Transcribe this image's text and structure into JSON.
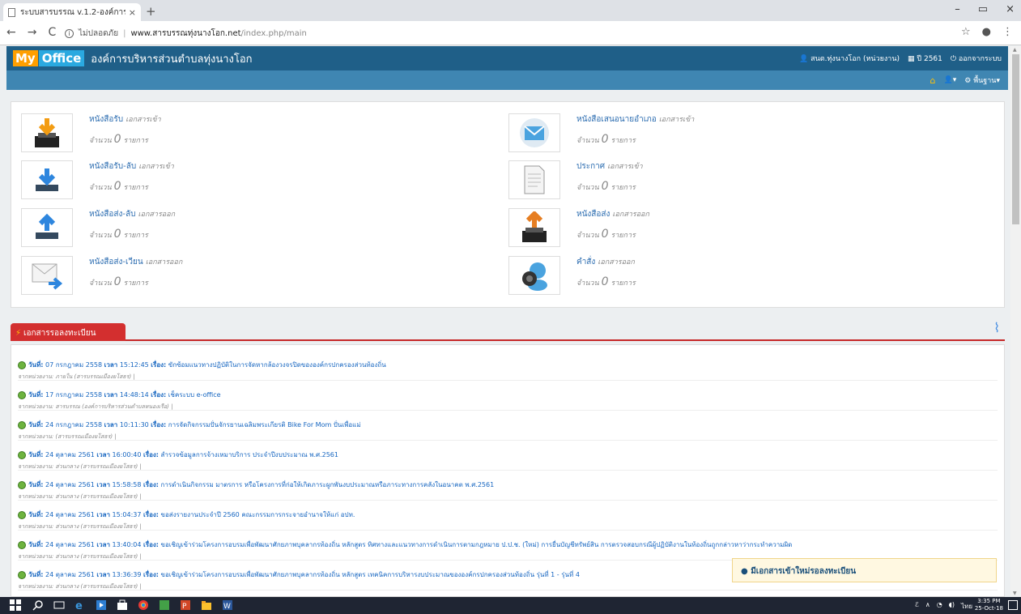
{
  "browser": {
    "tab_title": "ระบบสารบรรณ v.1.2-องค์การบริหาร",
    "tab_close": "×",
    "new_tab": "+",
    "win_min": "–",
    "win_max": "▭",
    "win_close": "×",
    "security": "ไม่ปลอดภัย",
    "url_domain": "www.สารบรรณทุ่งนางโอก.net",
    "url_path": "/index.php/main"
  },
  "app": {
    "logo_my": "My",
    "logo_office": "Office",
    "org_name": "องค์การบริหารส่วนตำบลทุ่งนางโอก",
    "user": "สนต.ทุ่งนางโอก (หน่วยงาน)",
    "year": "ปี 2561",
    "logout": "ออกจากระบบ",
    "menu_basic": "พื้นฐาน"
  },
  "docs": [
    {
      "title": "หนังสือรับ",
      "sub": "เอกสารเข้า",
      "count_prefix": "จำนวน",
      "count": "0",
      "count_suffix": "รายการ",
      "icon": "inbox-tray-icon"
    },
    {
      "title": "หนังสือเสนอนายอำเภอ",
      "sub": "เอกสารเข้า",
      "count_prefix": "จำนวน",
      "count": "0",
      "count_suffix": "รายการ",
      "icon": "envelope-icon"
    },
    {
      "title": "หนังสือรับ-ลับ",
      "sub": "เอกสารเข้า",
      "count_prefix": "จำนวน",
      "count": "0",
      "count_suffix": "รายการ",
      "icon": "download-icon"
    },
    {
      "title": "ประกาศ",
      "sub": "เอกสารเข้า",
      "count_prefix": "จำนวน",
      "count": "0",
      "count_suffix": "รายการ",
      "icon": "document-icon"
    },
    {
      "title": "หนังสือส่ง-ลับ",
      "sub": "เอกสารออก",
      "count_prefix": "จำนวน",
      "count": "0",
      "count_suffix": "รายการ",
      "icon": "upload-icon"
    },
    {
      "title": "หนังสือส่ง",
      "sub": "เอกสารออก",
      "count_prefix": "จำนวน",
      "count": "0",
      "count_suffix": "รายการ",
      "icon": "outbox-tray-icon"
    },
    {
      "title": "หนังสือส่ง-เวียน",
      "sub": "เอกสารออก",
      "count_prefix": "จำนวน",
      "count": "0",
      "count_suffix": "รายการ",
      "icon": "mail-forward-icon"
    },
    {
      "title": "คำสั่ง",
      "sub": "เอกสารออก",
      "count_prefix": "จำนวน",
      "count": "0",
      "count_suffix": "รายการ",
      "icon": "speaker-icon"
    }
  ],
  "pending": {
    "header": "เอกสารรอลงทะเบียน",
    "label_date": "วันที่:",
    "label_time": "เวลา",
    "label_subject": "เรื่อง:",
    "items": [
      {
        "date": "07 กรกฎาคม 2558",
        "time": "15:12:45",
        "subject": "ขักซ้อมแนวทางปฏิบัติในการจัดหากล้องวงจรปิดขององค์กรปกครองส่วนท้องถิ่น",
        "from": "จากหน่วยงาน: ภายใน (สารบรรณเมืองยโสธร) |"
      },
      {
        "date": "17 กรกฎาคม 2558",
        "time": "14:48:14",
        "subject": "เช็คระบบ e-office",
        "from": "จากหน่วยงาน: สารบรรณ (องค์การบริหารส่วนตำบลหนองเรือ) |"
      },
      {
        "date": "24 กรกฎาคม 2558",
        "time": "10:11:30",
        "subject": "การจัดกิจกรรมปั่นจักรยานเฉลิมพระเกียรติ Bike For Mom ปั่นเพื่อแม่",
        "from": "จากหน่วยงาน: (สารบรรณเมืองยโสธร) |"
      },
      {
        "date": "24 ตุลาคม 2561",
        "time": "16:00:40",
        "subject": "สำรวจข้อมูลการจ้างเหมาบริการ ประจำปีงบประมาณ พ.ศ.2561",
        "from": "จากหน่วยงาน: ส่วนกลาง (สารบรรณเมืองยโสธร) |"
      },
      {
        "date": "24 ตุลาคม 2561",
        "time": "15:58:58",
        "subject": "การดำเนินกิจกรรม มาตรการ หรือโครงการที่ก่อให้เกิดภาระผูกพันงบประมาณหรือภาระทางการคลังในอนาคต พ.ศ.2561",
        "from": "จากหน่วยงาน: ส่วนกลาง (สารบรรณเมืองยโสธร) |"
      },
      {
        "date": "24 ตุลาคม 2561",
        "time": "15:04:37",
        "subject": "ขอส่งรายงานประจำปี 2560 คณะกรรมการกระจายอำนาจให้แก่ อปท.",
        "from": "จากหน่วยงาน: ส่วนกลาง (สารบรรณเมืองยโสธร) |"
      },
      {
        "date": "24 ตุลาคม 2561",
        "time": "13:40:04",
        "subject": "ขอเชิญเข้าร่วมโครงการอบรมเพื่อพัฒนาศักยภาพบุคลากรท้องถิ่น หลักสูตร ทิศทางและแนวทางการดำเนินการตามกฎหมาย ป.ป.ช. (ใหม่) การยื่นบัญชีทรัพย์สิน การตรวจสอบกรณีผู้ปฏิบัติงานในท้องถิ่นถูกกล่าวหาว่ากระทำความผิด",
        "from": "จากหน่วยงาน: ส่วนกลาง (สารบรรณเมืองยโสธร) |"
      },
      {
        "date": "24 ตุลาคม 2561",
        "time": "13:36:39",
        "subject": "ขอเชิญเข้าร่วมโครงการอบรมเพื่อพัฒนาศักยภาพบุคลากรท้องถิ่น หลักสูตร เทคนิคการบริหารงบประมาณขององค์กรปกครองส่วนท้องถิ่น รุ่นที่ 1 - รุ่นที่ 4",
        "from": "จากหน่วยงาน: ส่วนกลาง (สารบรรณเมืองยโสธร) |"
      }
    ]
  },
  "notice": "มีเอกสารเข้าใหม่รอลงทะเบียน",
  "taskbar": {
    "time": "3:35 PM",
    "date": "25-Oct-18",
    "lang": "ไทย"
  }
}
